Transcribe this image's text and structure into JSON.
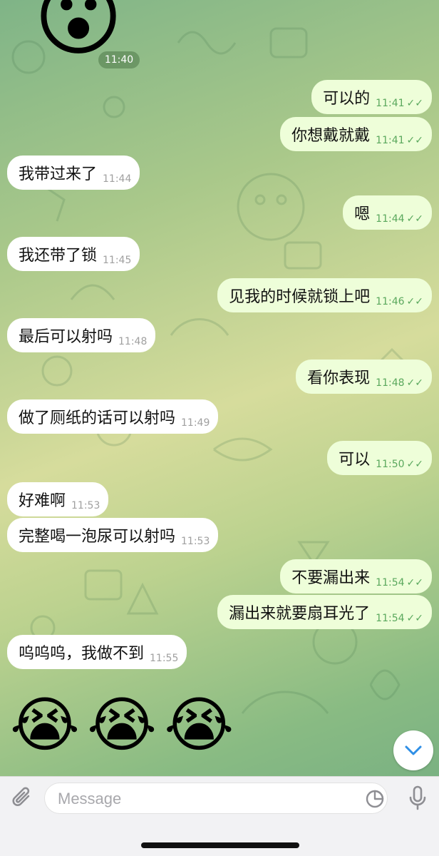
{
  "chat": {
    "date_time": "11:40",
    "messages": [
      {
        "dir": "out",
        "text": "可以的",
        "time": "11:41",
        "ticks": "✓✓"
      },
      {
        "dir": "out",
        "text": "你想戴就戴",
        "time": "11:41",
        "ticks": "✓✓"
      },
      {
        "dir": "in",
        "text": "我带过来了",
        "time": "11:44"
      },
      {
        "dir": "out",
        "text": "嗯",
        "time": "11:44",
        "ticks": "✓✓"
      },
      {
        "dir": "in",
        "text": "我还带了锁",
        "time": "11:45"
      },
      {
        "dir": "out",
        "text": "见我的时候就锁上吧",
        "time": "11:46",
        "ticks": "✓✓"
      },
      {
        "dir": "in",
        "text": "最后可以射吗",
        "time": "11:48"
      },
      {
        "dir": "out",
        "text": "看你表现",
        "time": "11:48",
        "ticks": "✓✓"
      },
      {
        "dir": "in",
        "text": "做了厕纸的话可以射吗",
        "time": "11:49"
      },
      {
        "dir": "out",
        "text": "可以",
        "time": "11:50",
        "ticks": "✓✓"
      },
      {
        "dir": "in",
        "text": "好难啊",
        "time": "11:53"
      },
      {
        "dir": "in",
        "text": "完整喝一泡尿可以射吗",
        "time": "11:53"
      },
      {
        "dir": "out",
        "text": "不要漏出来",
        "time": "11:54",
        "ticks": "✓✓"
      },
      {
        "dir": "out",
        "text": "漏出来就要扇耳光了",
        "time": "11:54",
        "ticks": "✓✓"
      },
      {
        "dir": "in",
        "text": "呜呜呜，我做不到",
        "time": "11:55"
      }
    ],
    "top_emoji": "😮",
    "crying_emojis": [
      "😭",
      "😭",
      "😭"
    ]
  },
  "composer": {
    "placeholder": "Message",
    "attach_icon": "paperclip-icon",
    "sticker_icon": "sticker-icon",
    "mic_icon": "microphone-icon"
  },
  "scroll_button_icon": "chevron-down-icon",
  "colors": {
    "incoming_bubble": "#ffffff",
    "outgoing_bubble": "#eefed9",
    "read_ticks": "#5aa85d",
    "accent": "#2f8fe6"
  }
}
